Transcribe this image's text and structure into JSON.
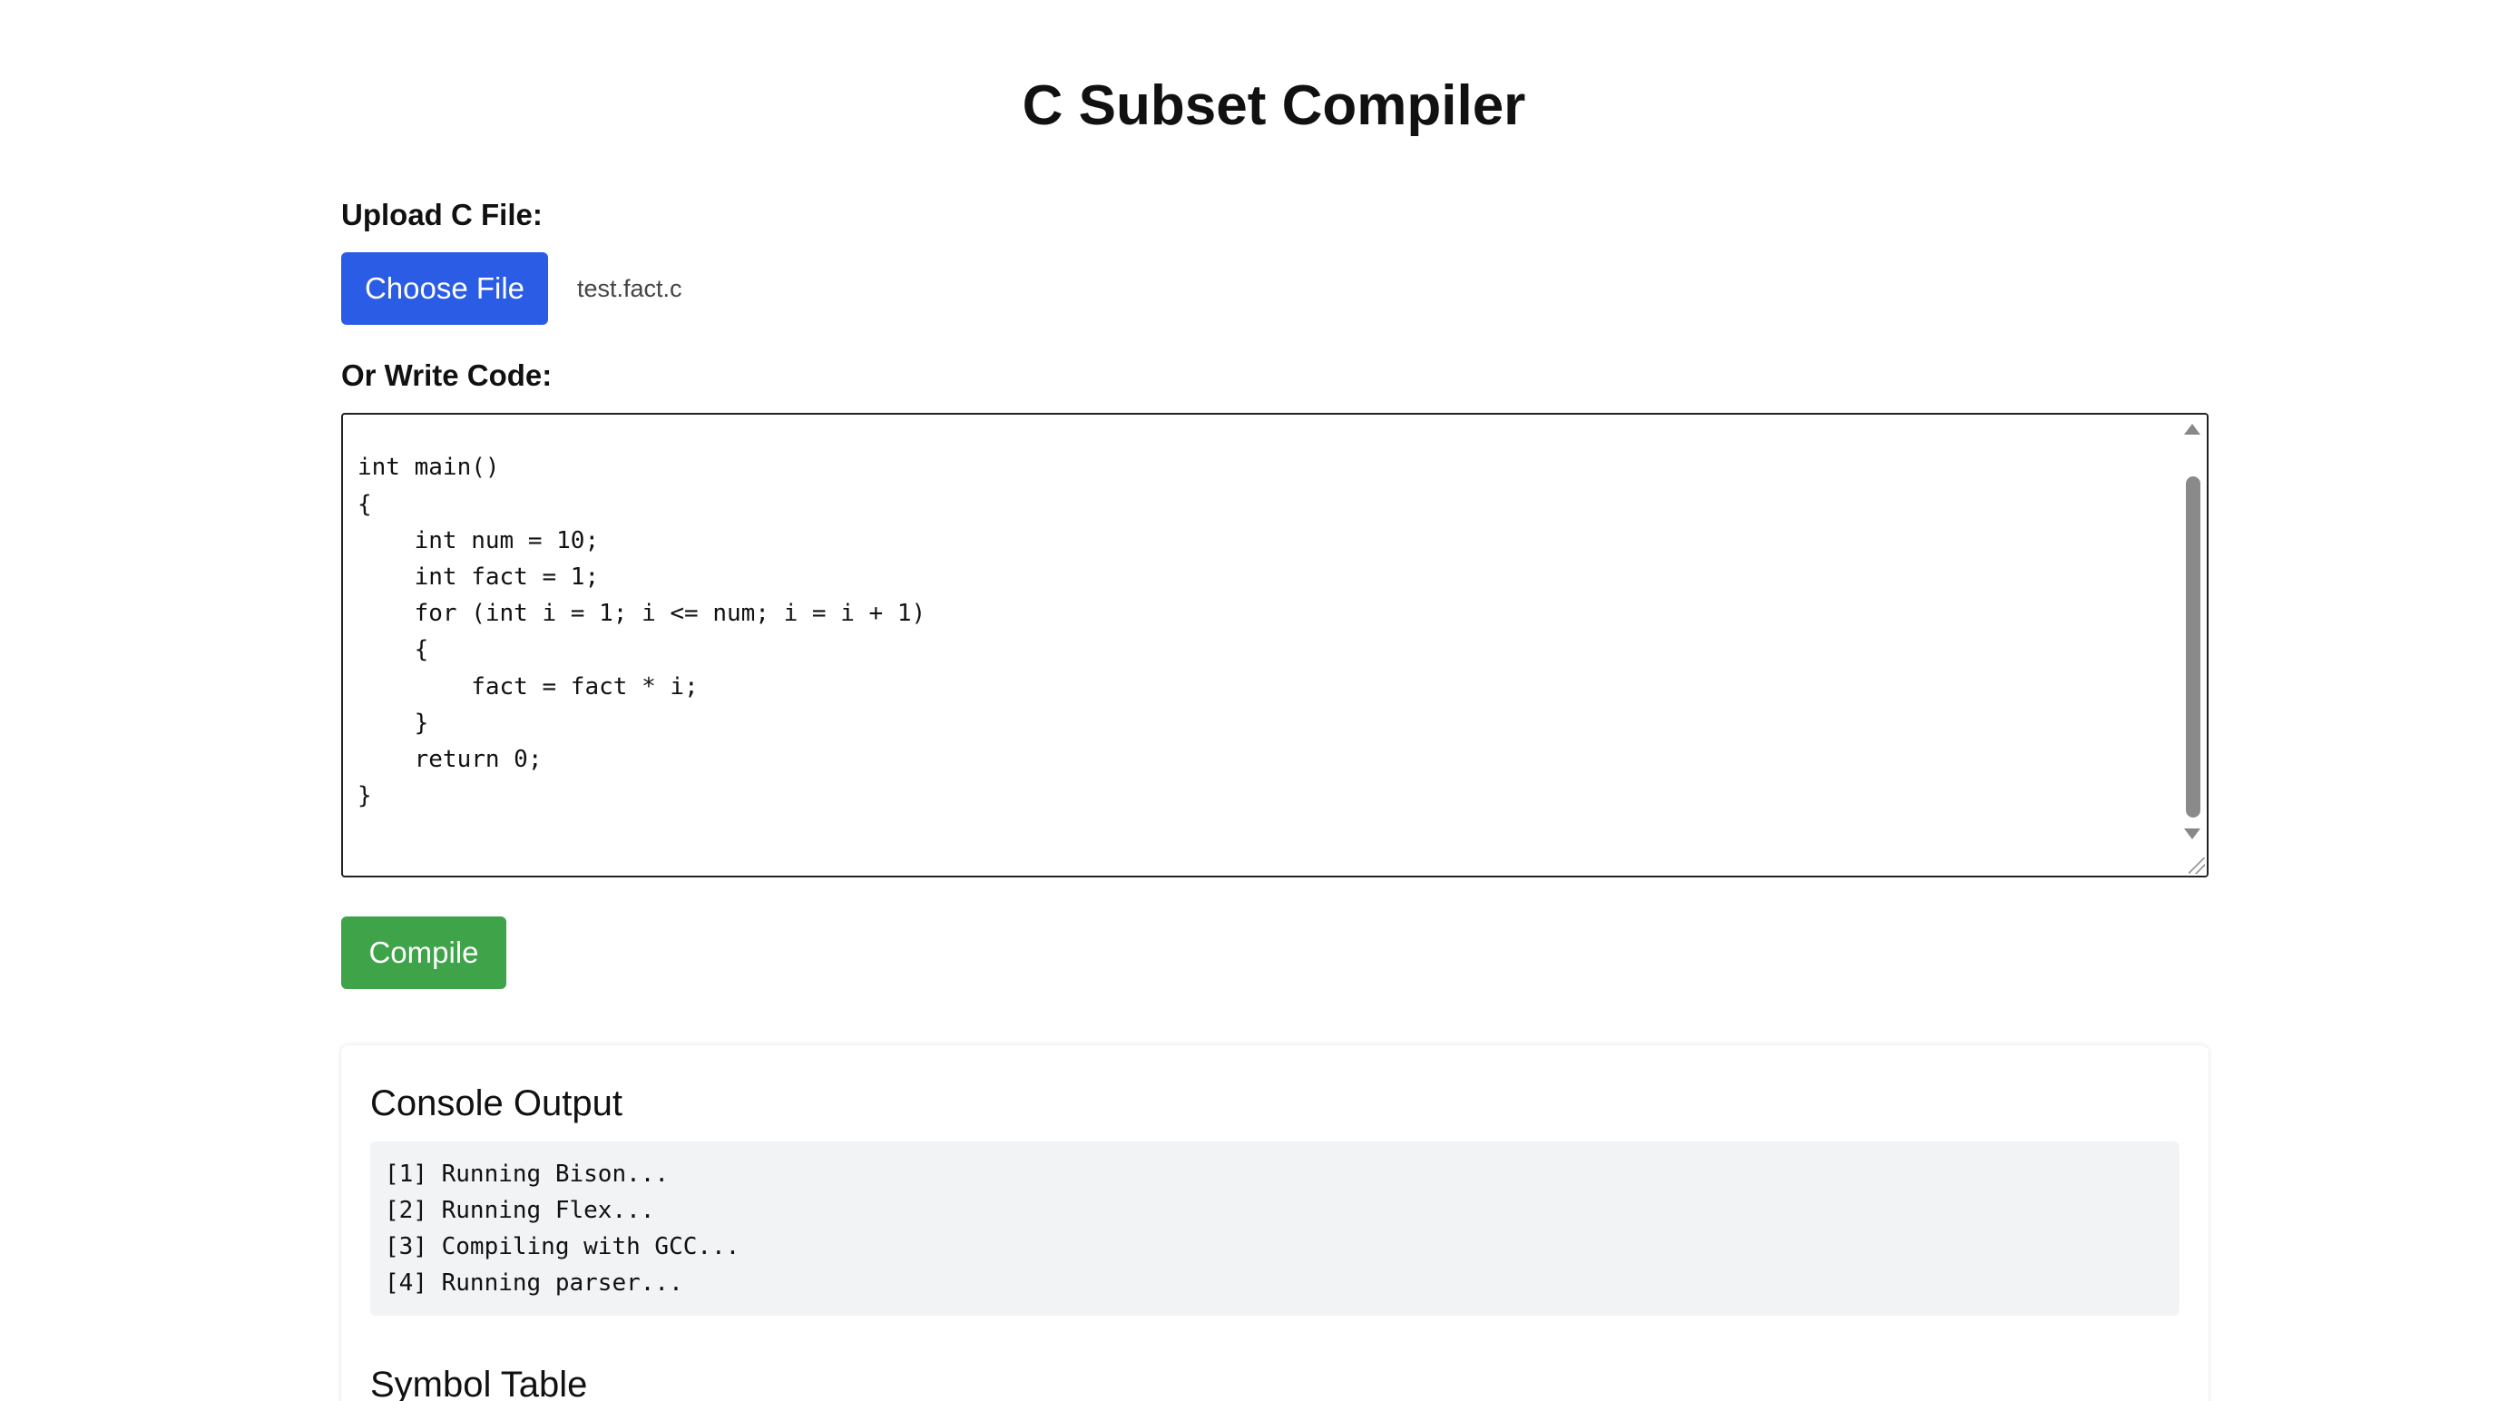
{
  "header": {
    "title": "C Subset Compiler"
  },
  "upload": {
    "label": "Upload C File:",
    "button_label": "Choose File",
    "file_name": "test.fact.c"
  },
  "editor": {
    "label": "Or Write Code:",
    "code": "#include <stdio.h>\n\nint main()\n{\n    int num = 10;\n    int fact = 1;\n    for (int i = 1; i <= num; i = i + 1)\n    {\n        fact = fact * i;\n    }\n    return 0;\n}\n"
  },
  "compile": {
    "button_label": "Compile"
  },
  "console": {
    "title": "Console Output",
    "lines": "[1] Running Bison...\n[2] Running Flex...\n[3] Compiling with GCC...\n[4] Running parser..."
  },
  "symbol_table": {
    "title": "Symbol Table"
  },
  "colors": {
    "primary_button": "#2b5ce6",
    "compile_button": "#3ea349",
    "console_background": "#f2f3f5"
  }
}
